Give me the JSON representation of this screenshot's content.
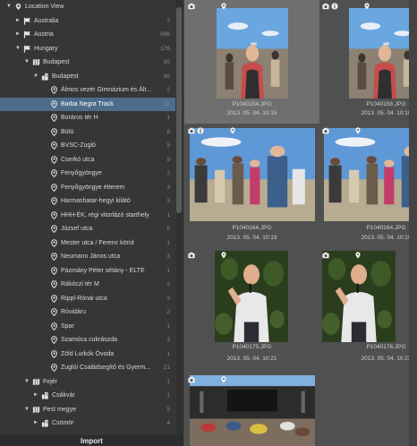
{
  "tree": {
    "rows": [
      {
        "label": "Location View",
        "count": "",
        "indent": 0,
        "arrow": "▼",
        "icon": "location-view-icon"
      },
      {
        "label": "Australia",
        "count": "2",
        "indent": 1,
        "arrow": "►",
        "icon": "flag-icon"
      },
      {
        "label": "Austria",
        "count": "996",
        "indent": 1,
        "arrow": "►",
        "icon": "flag-icon"
      },
      {
        "label": "Hungary",
        "count": "176",
        "indent": 1,
        "arrow": "▼",
        "icon": "flag-icon"
      },
      {
        "label": "Budapest",
        "count": "90",
        "indent": 2,
        "arrow": "▼",
        "icon": "map-icon"
      },
      {
        "label": "Budapest",
        "count": "90",
        "indent": 3,
        "arrow": "▼",
        "icon": "city-icon"
      },
      {
        "label": "Álmos vezér Gimnázium és Ált...",
        "count": "2",
        "indent": 4,
        "arrow": "",
        "icon": "pin-icon"
      },
      {
        "label": "Barba Negra Track",
        "count": "12",
        "indent": 4,
        "arrow": "",
        "icon": "pin-icon",
        "selected": true
      },
      {
        "label": "Boráros tér H",
        "count": "1",
        "indent": 4,
        "arrow": "",
        "icon": "pin-icon"
      },
      {
        "label": "Bütü",
        "count": "8",
        "indent": 4,
        "arrow": "",
        "icon": "pin-icon"
      },
      {
        "label": "BVSC-Zugló",
        "count": "5",
        "indent": 4,
        "arrow": "",
        "icon": "pin-icon"
      },
      {
        "label": "Cserkó utca",
        "count": "9",
        "indent": 4,
        "arrow": "",
        "icon": "pin-icon"
      },
      {
        "label": "Fenyőgyöngye",
        "count": "2",
        "indent": 4,
        "arrow": "",
        "icon": "pin-icon"
      },
      {
        "label": "Fenyőgyöngye étterem",
        "count": "3",
        "indent": 4,
        "arrow": "",
        "icon": "pin-icon"
      },
      {
        "label": "Harmashatar-hegyi kilátó",
        "count": "3",
        "indent": 4,
        "arrow": "",
        "icon": "pin-icon"
      },
      {
        "label": "HHH-ÉK, régi vitorlázó starthely",
        "count": "1",
        "indent": 4,
        "arrow": "",
        "icon": "pin-icon"
      },
      {
        "label": "József utca",
        "count": "5",
        "indent": 4,
        "arrow": "",
        "icon": "pin-icon"
      },
      {
        "label": "Mester utca / Ferenc körút",
        "count": "1",
        "indent": 4,
        "arrow": "",
        "icon": "pin-icon"
      },
      {
        "label": "Neumann János utca",
        "count": "3",
        "indent": 4,
        "arrow": "",
        "icon": "pin-icon"
      },
      {
        "label": "Pázmány Péter sétány - ELTE",
        "count": "1",
        "indent": 4,
        "arrow": "",
        "icon": "pin-icon"
      },
      {
        "label": "Rákóczi tér M",
        "count": "2",
        "indent": 4,
        "arrow": "",
        "icon": "pin-icon"
      },
      {
        "label": "Rippl-Rónai utca",
        "count": "3",
        "indent": 4,
        "arrow": "",
        "icon": "pin-icon"
      },
      {
        "label": "Róvidáru",
        "count": "2",
        "indent": 4,
        "arrow": "",
        "icon": "pin-icon"
      },
      {
        "label": "Spar",
        "count": "1",
        "indent": 4,
        "arrow": "",
        "icon": "pin-icon"
      },
      {
        "label": "Szamóca cukrászda",
        "count": "3",
        "indent": 4,
        "arrow": "",
        "icon": "pin-icon"
      },
      {
        "label": "Zöld Lurkók Óvoda",
        "count": "1",
        "indent": 4,
        "arrow": "",
        "icon": "pin-icon"
      },
      {
        "label": "Zuglói Családsegítő és Gyerm...",
        "count": "21",
        "indent": 4,
        "arrow": "",
        "icon": "pin-icon"
      },
      {
        "label": "Fejér",
        "count": "1",
        "indent": 2,
        "arrow": "▼",
        "icon": "map-icon"
      },
      {
        "label": "Csákvár",
        "count": "1",
        "indent": 3,
        "arrow": "►",
        "icon": "city-icon"
      },
      {
        "label": "Pest megye",
        "count": "5",
        "indent": 2,
        "arrow": "▼",
        "icon": "map-icon"
      },
      {
        "label": "Csömör",
        "count": "4",
        "indent": 3,
        "arrow": "►",
        "icon": "city-icon"
      }
    ],
    "import_label": "Import"
  },
  "grid": {
    "cells": [
      {
        "name": "P1040154.JPG",
        "date": "2013. 05. 04. 10:15",
        "badges": [
          "camera-icon",
          "location-pin-icon"
        ],
        "selected": true,
        "scene": "portrait-crowd"
      },
      {
        "name": "P1040158.JPG",
        "date": "2013. 05. 04. 10:16",
        "badges": [
          "camera-icon",
          "info-icon",
          "location-pin-icon"
        ],
        "selected": false,
        "scene": "portrait-crowd"
      },
      {
        "name": "P1040164.JPG",
        "date": "2013. 05. 04. 10:19",
        "badges": [
          "camera-icon",
          "info-icon",
          "location-pin-icon"
        ],
        "selected": false,
        "scene": "crowd-landscape"
      },
      {
        "name": "P1040164.JPG",
        "date": "2013. 05. 04. 10:19",
        "badges": [
          "camera-icon",
          "location-pin-icon"
        ],
        "selected": false,
        "scene": "crowd-landscape"
      },
      {
        "name": "P1040175.JPG",
        "date": "2013. 05. 04. 10:21",
        "badges": [
          "camera-icon",
          "location-pin-icon"
        ],
        "selected": false,
        "scene": "singer"
      },
      {
        "name": "P1040176.JPG",
        "date": "2013. 05. 04. 10:22",
        "badges": [
          "camera-icon",
          "location-pin-icon"
        ],
        "selected": false,
        "scene": "singer"
      },
      {
        "name": "",
        "date": "",
        "badges": [
          "camera-icon",
          "location-pin-icon"
        ],
        "selected": false,
        "scene": "stage"
      }
    ]
  },
  "colors": {
    "selected_row": "#4e6d8c",
    "panel_bg": "#363636",
    "grid_bg": "#505050"
  }
}
